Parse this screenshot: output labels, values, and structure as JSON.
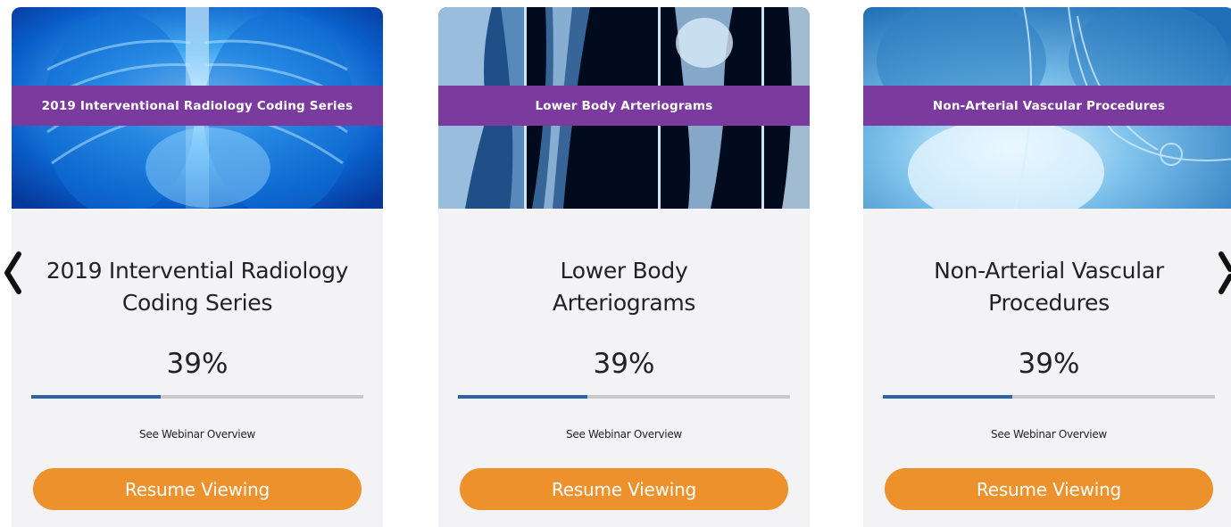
{
  "carousel": {
    "prev_icon": "chevron-left-icon",
    "next_icon": "chevron-right-icon",
    "cards": [
      {
        "banner": "2019 Interventional Radiology Coding Series",
        "title_line1": "2019 Intervential Radiology",
        "title_line2": "Coding Series",
        "percent_label": "39%",
        "progress": 0.39,
        "overview_link": "See Webinar Overview",
        "resume_label": "Resume Viewing"
      },
      {
        "banner": "Lower Body Arteriograms",
        "title_line1": "Lower Body",
        "title_line2": "Arteriograms",
        "percent_label": "39%",
        "progress": 0.39,
        "overview_link": "See Webinar Overview",
        "resume_label": "Resume Viewing"
      },
      {
        "banner": "Non-Arterial Vascular Procedures",
        "title_line1": "Non-Arterial Vascular",
        "title_line2": "Procedures",
        "percent_label": "39%",
        "progress": 0.39,
        "overview_link": "See Webinar Overview",
        "resume_label": "Resume Viewing"
      }
    ]
  },
  "colors": {
    "banner": "#7b3b9e",
    "button": "#ec912c",
    "progress_fill": "#2f63a8",
    "progress_track": "#c9c9cb",
    "card_bg": "#f3f3f5"
  }
}
